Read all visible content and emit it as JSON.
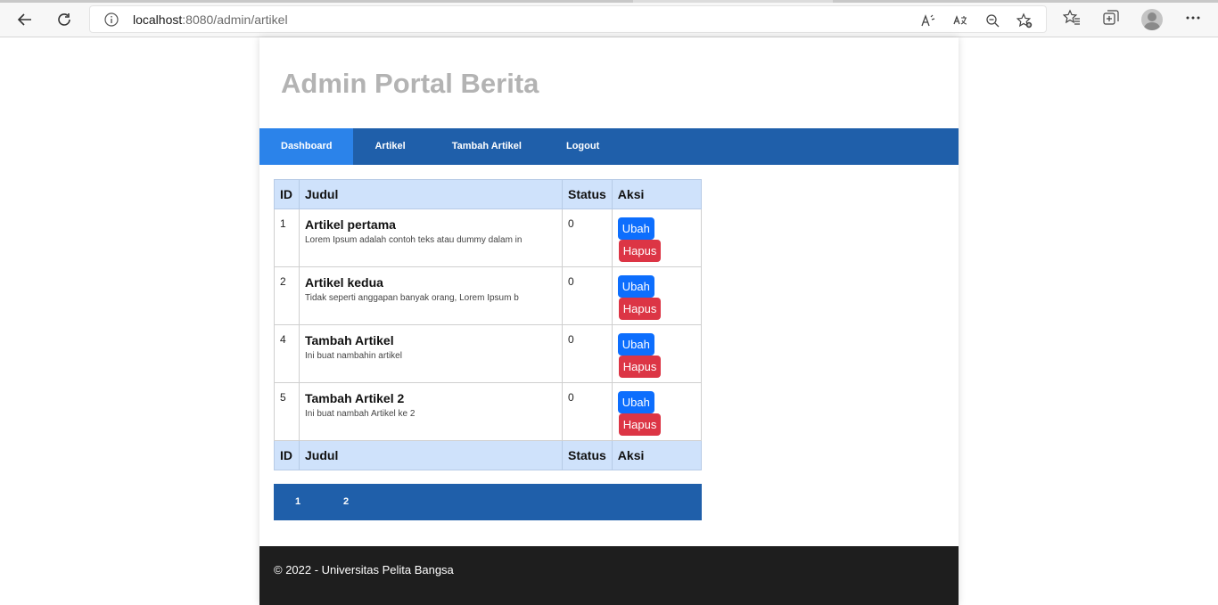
{
  "browser": {
    "url_host": "localhost",
    "url_rest": ":8080/admin/artikel"
  },
  "site": {
    "title": "Admin Portal Berita"
  },
  "nav": {
    "items": [
      {
        "label": "Dashboard"
      },
      {
        "label": "Artikel"
      },
      {
        "label": "Tambah Artikel"
      },
      {
        "label": "Logout"
      }
    ]
  },
  "table": {
    "headers": [
      "ID",
      "Judul",
      "Status",
      "Aksi"
    ],
    "rows": [
      {
        "id": "1",
        "judul": "Artikel pertama",
        "desc": "Lorem Ipsum adalah contoh teks atau dummy dalam in",
        "status": "0",
        "edit": "Ubah",
        "delete": "Hapus"
      },
      {
        "id": "2",
        "judul": "Artikel kedua",
        "desc": "Tidak seperti anggapan banyak orang, Lorem Ipsum b",
        "status": "0",
        "edit": "Ubah",
        "delete": "Hapus"
      },
      {
        "id": "4",
        "judul": "Tambah Artikel",
        "desc": "Ini buat nambahin artikel",
        "status": "0",
        "edit": "Ubah",
        "delete": "Hapus"
      },
      {
        "id": "5",
        "judul": "Tambah Artikel 2",
        "desc": "Ini buat nambah Artikel ke 2",
        "status": "0",
        "edit": "Ubah",
        "delete": "Hapus"
      }
    ]
  },
  "pagination": {
    "pages": [
      "1",
      "2"
    ]
  },
  "footer": {
    "text": "© 2022 - Universitas Pelita Bangsa"
  },
  "colors": {
    "navbar": "#1f5faa",
    "nav_active": "#2b83ea",
    "table_header": "#cfe2fb",
    "btn_ubah": "#0d6efd",
    "btn_hapus": "#dc3545",
    "footer": "#1e1e1e"
  }
}
